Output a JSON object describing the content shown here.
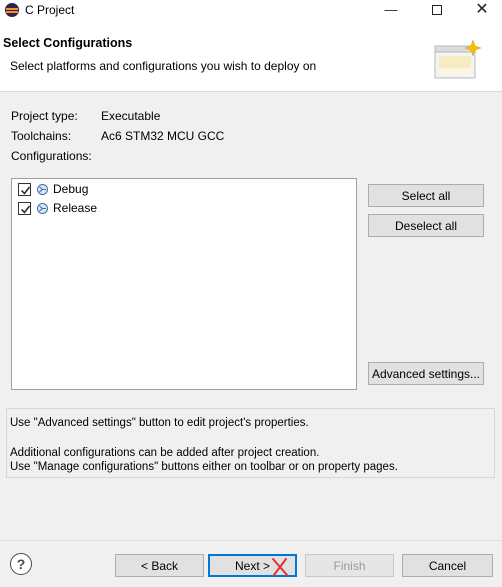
{
  "window": {
    "title": "C Project",
    "minimize": "—",
    "close": "✕"
  },
  "header": {
    "title": "Select Configurations",
    "description": "Select platforms and configurations you wish to deploy on"
  },
  "info": {
    "project_type_label": "Project type:",
    "project_type_value": "Executable",
    "toolchains_label": "Toolchains:",
    "toolchains_value": "Ac6 STM32 MCU GCC",
    "configurations_label": "Configurations:"
  },
  "configurations": [
    {
      "label": "Debug",
      "checked": true
    },
    {
      "label": "Release",
      "checked": true
    }
  ],
  "side_buttons": {
    "select_all": "Select all",
    "deselect_all": "Deselect all",
    "advanced_settings": "Advanced settings..."
  },
  "messages": {
    "line1": "Use \"Advanced settings\" button to edit project's properties.",
    "line2": "Additional configurations can be added after project creation.",
    "line3": "Use \"Manage configurations\" buttons either on toolbar or on property pages."
  },
  "footer": {
    "help": "?",
    "back": "< Back",
    "next": "Next >",
    "finish": "Finish",
    "cancel": "Cancel"
  },
  "icons": {
    "app": "eclipse-icon",
    "config": "gear-icon",
    "banner": "wizard-banner-icon",
    "help": "help-icon"
  }
}
